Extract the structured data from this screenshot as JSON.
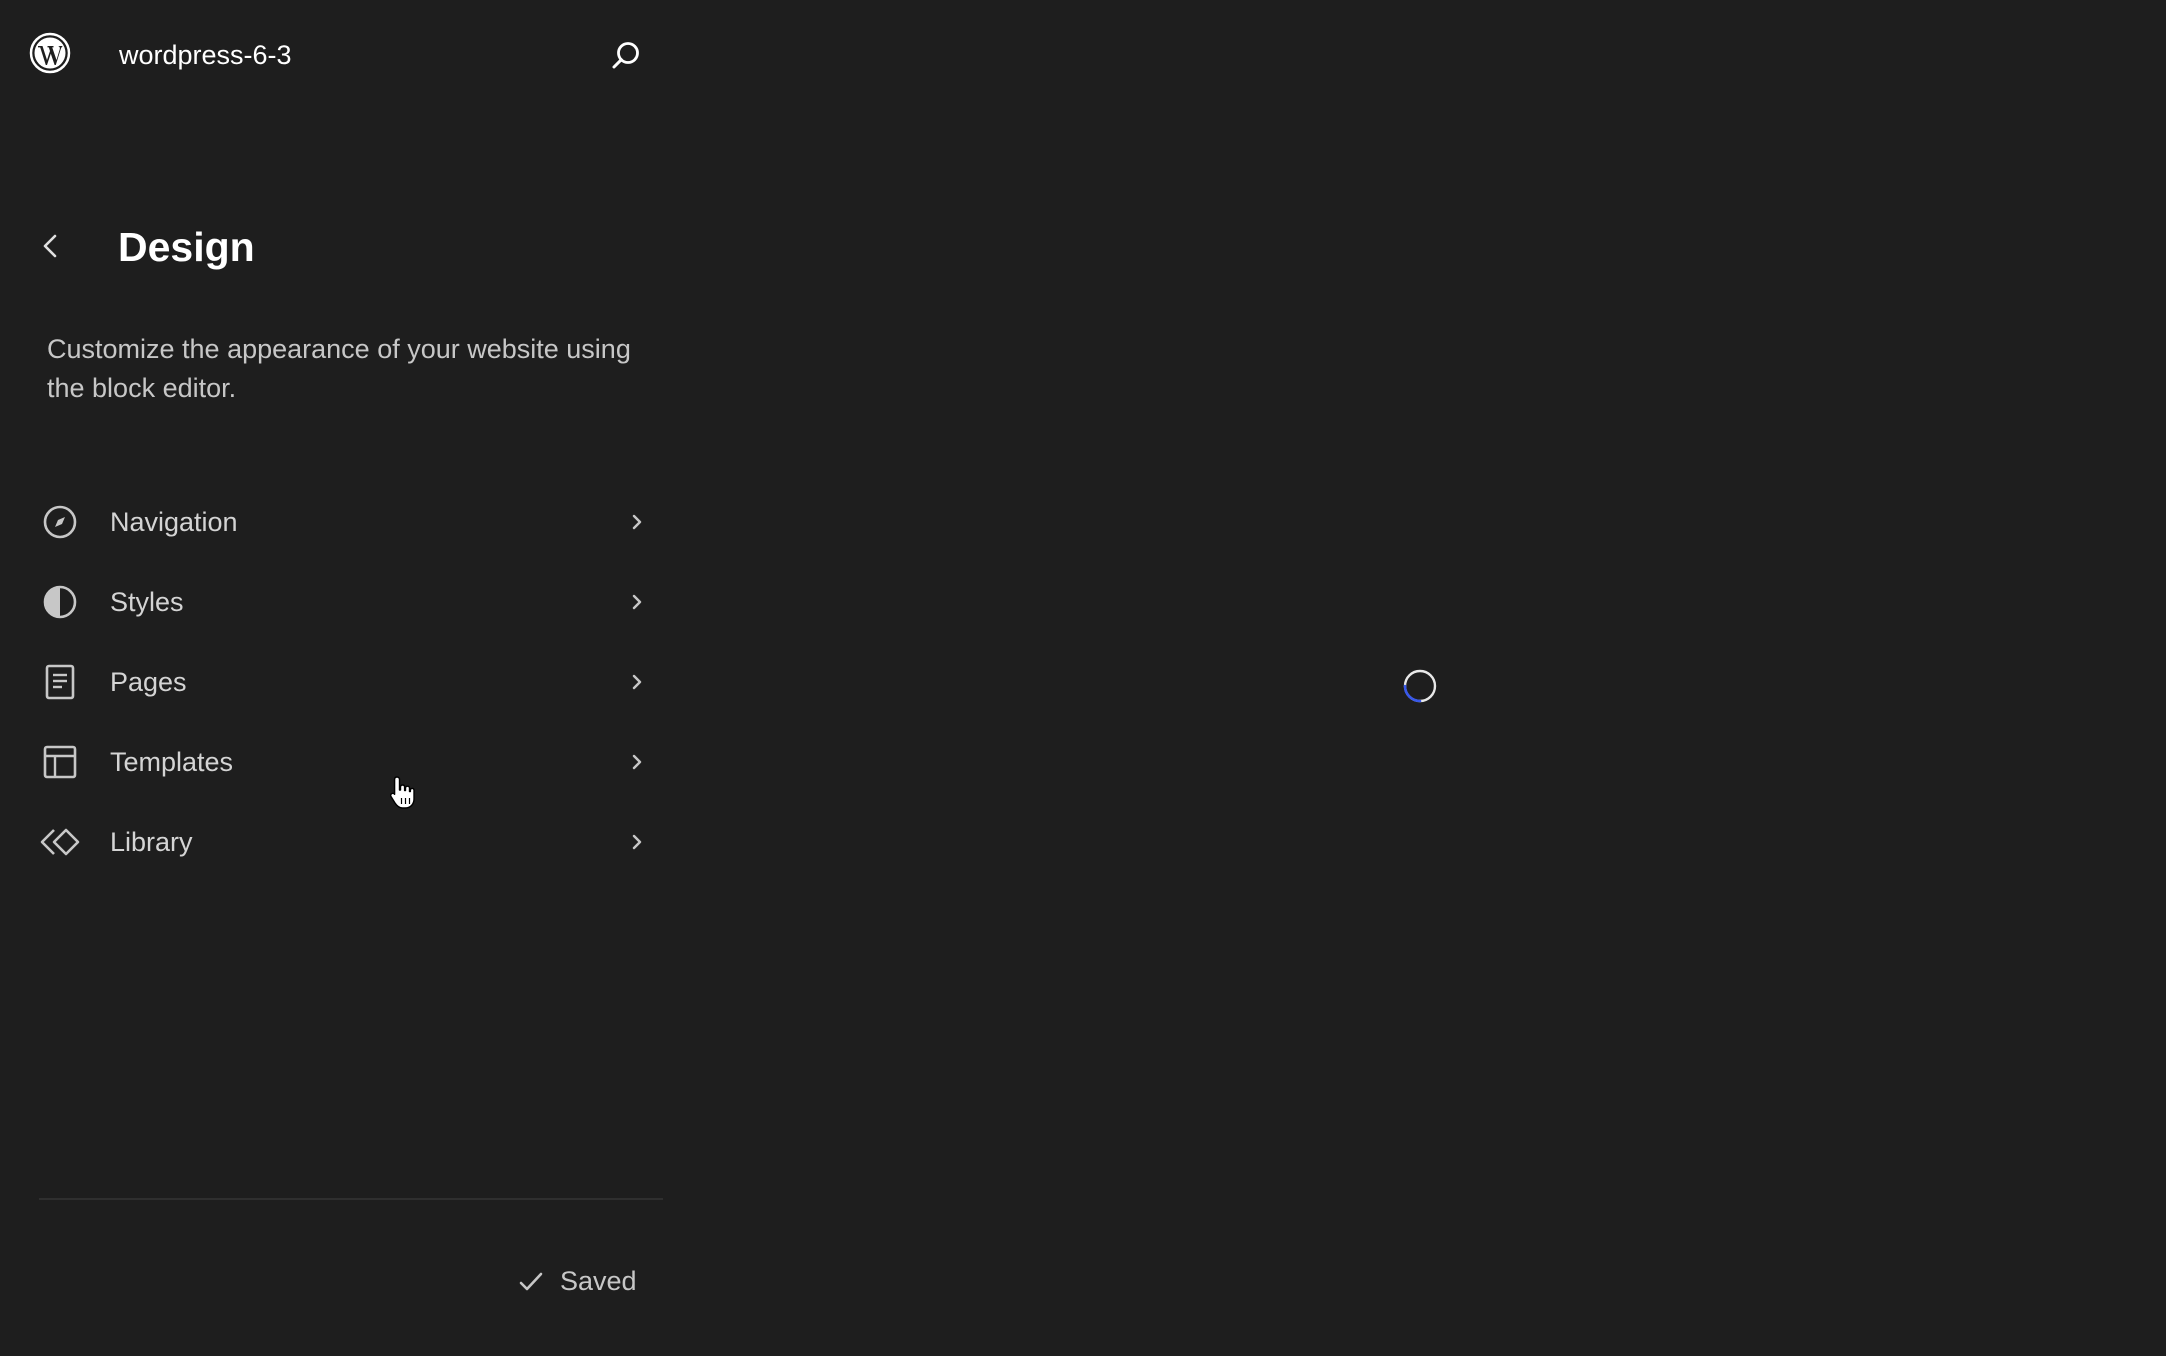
{
  "header": {
    "site_title": "wordpress-6-3",
    "logo_icon": "wordpress-logo-icon",
    "search_icon": "search-icon"
  },
  "sidebar": {
    "title": "Design",
    "description": "Customize the appearance of your website using the block editor.",
    "items": [
      {
        "label": "Navigation",
        "icon": "navigation-compass-icon"
      },
      {
        "label": "Styles",
        "icon": "styles-half-circle-icon"
      },
      {
        "label": "Pages",
        "icon": "pages-document-icon"
      },
      {
        "label": "Templates",
        "icon": "templates-layout-icon"
      },
      {
        "label": "Library",
        "icon": "library-symbol-icon"
      }
    ]
  },
  "footer": {
    "status": "Saved"
  },
  "colors": {
    "background": "#1e1e1e",
    "text": "#e0e0e0",
    "muted_text": "#c7c7c7",
    "spinner_accent": "#3858e9"
  }
}
